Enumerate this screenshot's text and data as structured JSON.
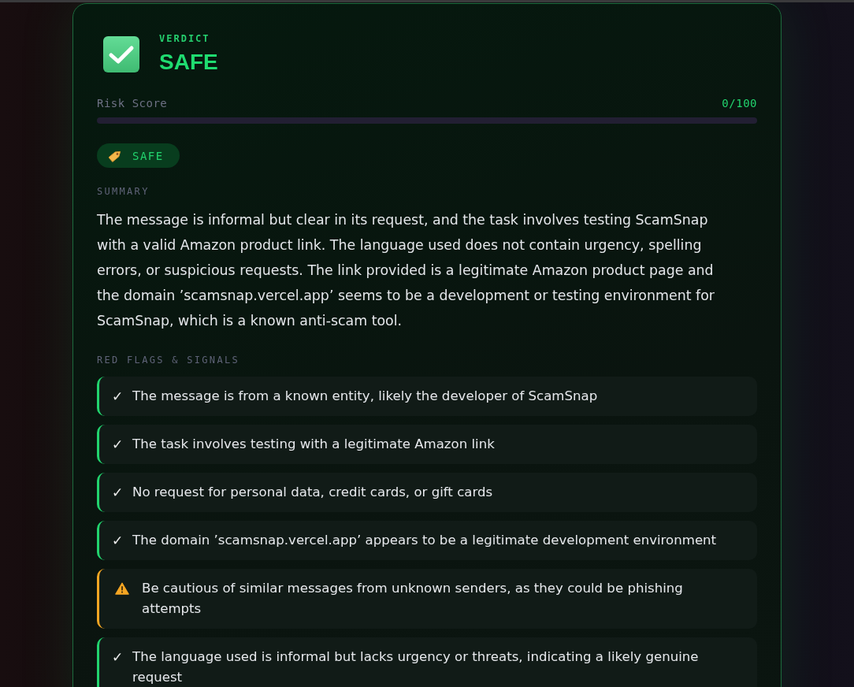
{
  "verdict": {
    "label": "VERDICT",
    "value": "SAFE"
  },
  "risk": {
    "label": "Risk Score",
    "reading": "0/100",
    "level": 0
  },
  "tag": {
    "label": "SAFE"
  },
  "summary": {
    "heading": "SUMMARY",
    "text": "The message is informal but clear in its request, and the task involves testing ScamSnap with a valid Amazon product link. The language used does not contain urgency, spelling errors, or suspicious requests. The link provided is a legitimate Amazon product page and the domain ’scamsnap.vercel.app’ seems to be a development or testing environment for ScamSnap, which is a known anti-scam tool."
  },
  "signals": {
    "heading": "RED FLAGS & SIGNALS",
    "items": [
      {
        "kind": "check",
        "icon": "✓",
        "text": "The message is from a known entity, likely the developer of ScamSnap"
      },
      {
        "kind": "check",
        "icon": "✓",
        "text": "The task involves testing with a legitimate Amazon link"
      },
      {
        "kind": "check",
        "icon": "✓",
        "text": "No request for personal data, credit cards, or gift cards"
      },
      {
        "kind": "check",
        "icon": "✓",
        "text": "The domain ’scamsnap.vercel.app’ appears to be a legitimate development environment"
      },
      {
        "kind": "warning",
        "text": "Be cautious of similar messages from unknown senders, as they could be phishing attempts"
      },
      {
        "kind": "check",
        "icon": "✓",
        "text": "The language used is informal but lacks urgency or threats, indicating a likely genuine request"
      }
    ]
  }
}
